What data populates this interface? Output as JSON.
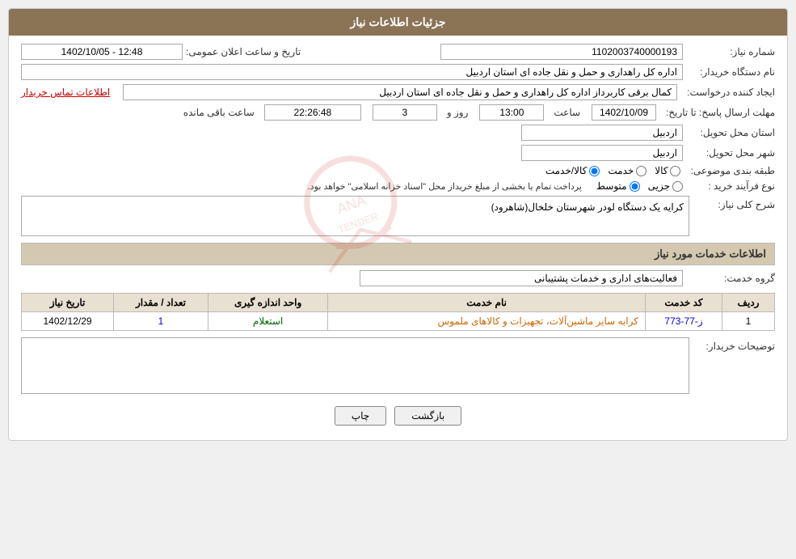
{
  "header": {
    "title": "جزئیات اطلاعات نیاز"
  },
  "fields": {
    "shomareNiaz_label": "شماره نیاز:",
    "shomareNiaz_value": "1102003740000193",
    "namDastgah_label": "نام دستگاه خریدار:",
    "namDastgah_value": "اداره کل راهداری و حمل و نقل جاده ای استان اردبیل",
    "tarikh_label": "تاریخ و ساعت اعلان عمومی:",
    "tarikh_value": "1402/10/05 - 12:48",
    "ijadKonande_label": "ایجاد کننده درخواست:",
    "ijadKonande_value": "کمال برقی کاربرداز اداره کل راهداری و حمل و نقل جاده ای استان اردبیل",
    "etelaat_link": "اطلاعات تماس خریدار",
    "mohlat_label": "مهلت ارسال پاسخ: تا تاریخ:",
    "mohlat_date": "1402/10/09",
    "mohlat_saat_label": "ساعت",
    "mohlat_saat": "13:00",
    "mohlat_roz_label": "روز و",
    "mohlat_roz": "3",
    "mohlat_baqi_label": "ساعت باقی مانده",
    "mohlat_baqi": "22:26:48",
    "ostan_label": "استان محل تحویل:",
    "ostan_value": "اردبیل",
    "shahr_label": "شهر محل تحویل:",
    "shahr_value": "اردبیل",
    "tabaqe_label": "طبقه بندی موضوعی:",
    "tabaqe_kala": "کالا",
    "tabaqe_khedmat": "خدمت",
    "tabaqe_kala_khedmat": "کالا/خدمت",
    "noe_label": "نوع فرآیند خرید :",
    "noe_jozi": "جزیی",
    "noe_motavaset": "متوسط",
    "noe_note": "پرداخت تمام یا بخشی از مبلغ خریداز محل \"اسناد خزانه اسلامی\" خواهد بود.",
    "sharh_label": "شرح کلی نیاز:",
    "sharh_value": "کرایه یک دستگاه لودر  شهرستان خلخال(شاهرود)",
    "services_section": "اطلاعات خدمات مورد نیاز",
    "grohe_label": "گروه خدمت:",
    "grohe_value": "فعالیت‌های اداری و خدمات پشتیبانی",
    "table": {
      "columns": [
        "ردیف",
        "کد خدمت",
        "نام خدمت",
        "واحد اندازه گیری",
        "تعداد / مقدار",
        "تاریخ نیاز"
      ],
      "rows": [
        {
          "radif": "1",
          "kod": "ز-77-773",
          "nam": "کرایه سایر ماشین‌آلات، تجهیزات و کالاهای ملموس",
          "vahed": "استعلام",
          "tedad": "1",
          "tarikh": "1402/12/29"
        }
      ]
    },
    "tosih_label": "توضیحات خریدار:"
  },
  "buttons": {
    "print": "چاپ",
    "back": "بازگشت"
  }
}
